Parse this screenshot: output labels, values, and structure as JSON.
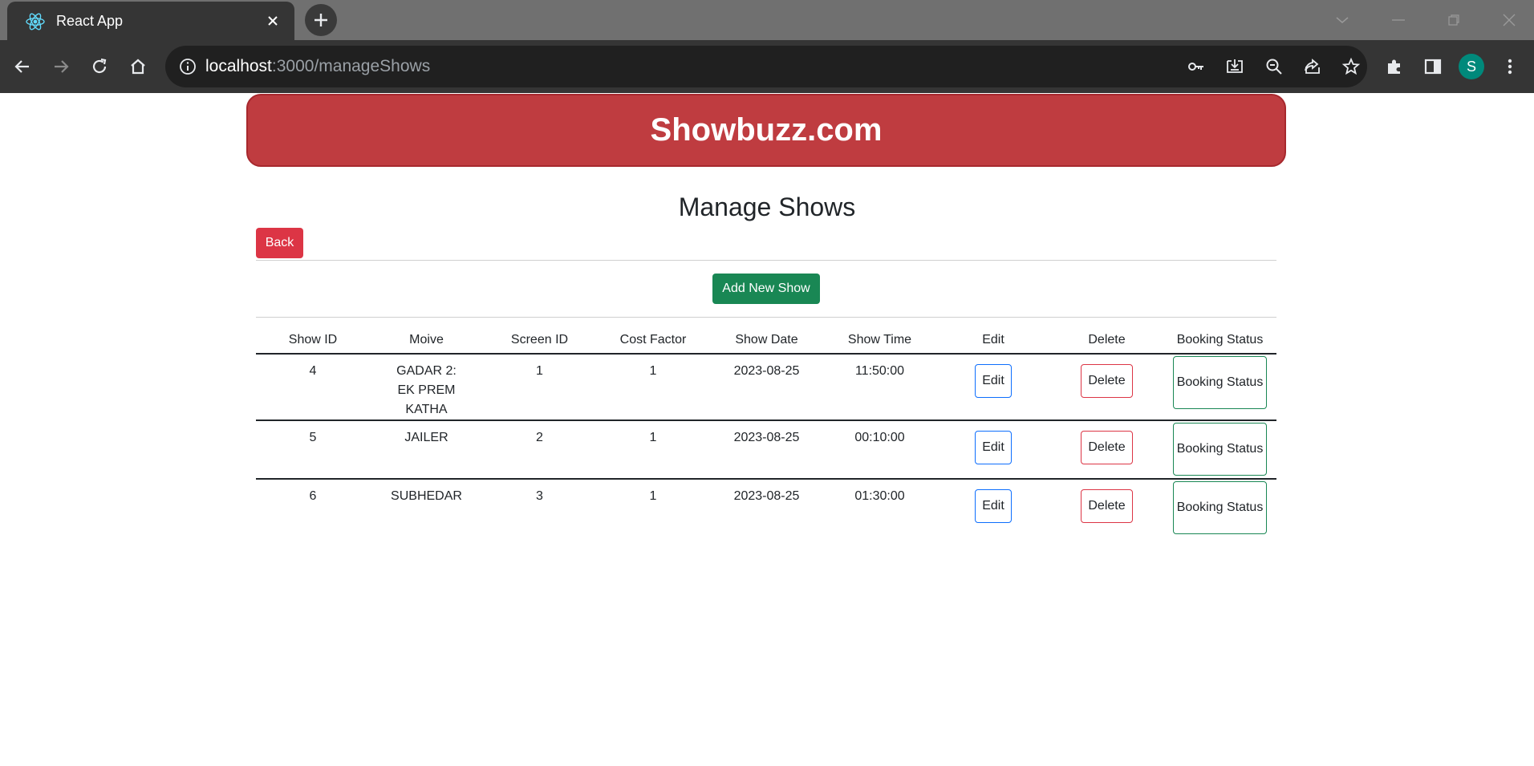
{
  "browser": {
    "tab_title": "React App",
    "url_host": "localhost",
    "url_path": ":3000/manageShows",
    "avatar_letter": "S",
    "icons": [
      "react-favicon",
      "close-icon",
      "plus-icon",
      "chevron-down-icon",
      "minimize-icon",
      "restore-icon",
      "window-close-icon",
      "back-arrow-icon",
      "forward-arrow-icon",
      "reload-icon",
      "home-icon",
      "info-icon",
      "key-icon",
      "install-icon",
      "zoom-out-icon",
      "share-icon",
      "star-icon",
      "extensions-icon",
      "side-panel-icon",
      "kebab-menu-icon"
    ]
  },
  "page": {
    "brand": "Showbuzz.com",
    "title": "Manage Shows",
    "back_label": "Back",
    "add_label": "Add New Show"
  },
  "table": {
    "headers": [
      "Show ID",
      "Moive",
      "Screen ID",
      "Cost Factor",
      "Show Date",
      "Show Time",
      "Edit",
      "Delete",
      "Booking Status"
    ],
    "edit_label": "Edit",
    "delete_label": "Delete",
    "status_label": "Booking Status",
    "rows": [
      {
        "show_id": "4",
        "movie": "GADAR 2: EK PREM KATHA",
        "screen_id": "1",
        "cost_factor": "1",
        "date": "2023-08-25",
        "time": "11:50:00"
      },
      {
        "show_id": "5",
        "movie": "JAILER",
        "screen_id": "2",
        "cost_factor": "1",
        "date": "2023-08-25",
        "time": "00:10:00"
      },
      {
        "show_id": "6",
        "movie": "SUBHEDAR",
        "screen_id": "3",
        "cost_factor": "1",
        "date": "2023-08-25",
        "time": "01:30:00"
      }
    ]
  },
  "colors": {
    "banner": "#bf3c40",
    "danger": "#dc3545",
    "success": "#198754",
    "primary": "#0d6efd"
  }
}
